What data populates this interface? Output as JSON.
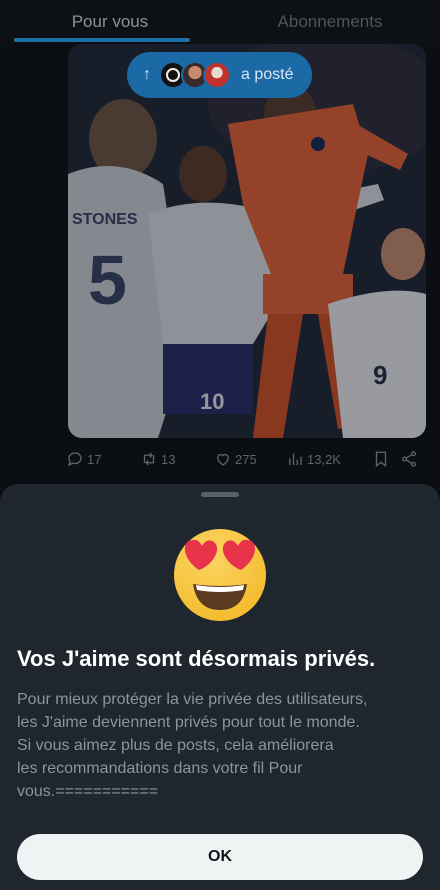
{
  "tabs": [
    {
      "label": "Pour vous",
      "active": true
    },
    {
      "label": "Abonnements",
      "active": false
    }
  ],
  "posted_pill": {
    "arrow": "↑",
    "label": "a posté"
  },
  "post_actions": {
    "replies": "17",
    "reposts": "13",
    "likes": "275",
    "views": "13,2K"
  },
  "sheet": {
    "emoji": "smiling-face-with-heart-eyes",
    "title": "Vos J'aime sont désormais privés.",
    "body": "Pour mieux protéger la vie privée des utilisateurs,\nles J'aime deviennent privés pour tout le monde.\nSi vous aimez plus de posts, cela améliorera\nles recommandations dans votre fil Pour\nvous.===========",
    "ok_label": "OK"
  },
  "colors": {
    "accent": "#1d6fa8",
    "sheet_bg": "#1f262d",
    "button_bg": "#eff3f4"
  }
}
